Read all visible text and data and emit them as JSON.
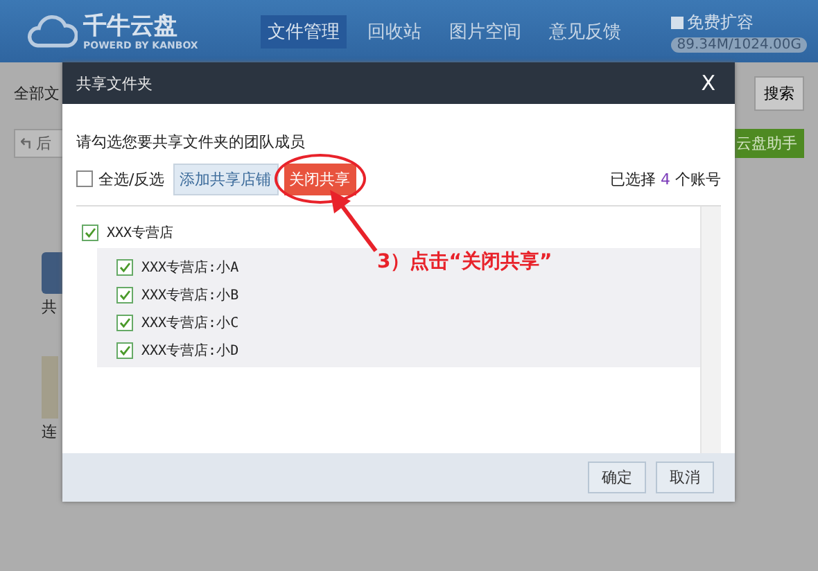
{
  "header": {
    "logo_title": "千牛云盘",
    "logo_subtitle": "POWERD BY KANBOX",
    "nav": [
      {
        "label": "文件管理",
        "selected": true
      },
      {
        "label": "回收站",
        "selected": false
      },
      {
        "label": "图片空间",
        "selected": false
      },
      {
        "label": "意见反馈",
        "selected": false
      }
    ],
    "upgrade_label": "免费扩容",
    "quota": "89.34M/1024.00G"
  },
  "background": {
    "breadcrumb": "全部文",
    "search_button": "搜索",
    "back_button": "后",
    "helper_button": "云盘助手",
    "folder_label": "共",
    "item_label": "连"
  },
  "dialog": {
    "title": "共享文件夹",
    "close": "X",
    "instruction": "请勾选您要共享文件夹的团队成员",
    "select_all": {
      "label": "全选/反选",
      "checked": false
    },
    "add_button": "添加共享店铺",
    "close_share_button": "关闭共享",
    "count_prefix": "已选择",
    "count": "4",
    "count_suffix": "个账号",
    "tree": [
      {
        "label": "XXX专营店",
        "checked": true,
        "children": [
          {
            "label": "XXX专营店:小A",
            "checked": true
          },
          {
            "label": "XXX专营店:小B",
            "checked": true
          },
          {
            "label": "XXX专营店:小C",
            "checked": true
          },
          {
            "label": "XXX专营店:小D",
            "checked": true
          }
        ]
      }
    ],
    "buttons": [
      "确定",
      "取消"
    ]
  },
  "annotation": {
    "text": "3）点击“关闭共享”"
  }
}
